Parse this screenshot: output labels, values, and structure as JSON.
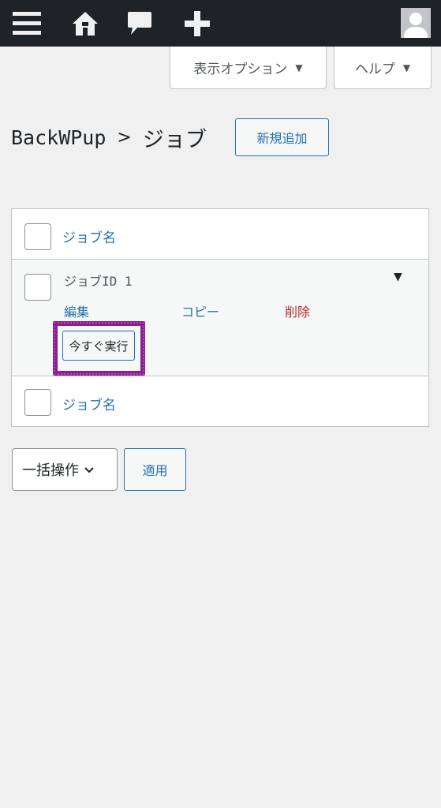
{
  "admin_bar": {
    "icons": [
      "menu-icon",
      "home-icon",
      "comments-icon",
      "plus-icon",
      "user-avatar-icon"
    ]
  },
  "screen_meta": {
    "screen_options_label": "表示オプション",
    "help_label": "ヘルプ"
  },
  "header": {
    "title": "BackWPup",
    "separator": ">",
    "subtitle": "ジョブ",
    "add_new_label": "新規追加"
  },
  "table": {
    "column_header": "ジョブ名",
    "column_footer": "ジョブ名",
    "rows": [
      {
        "name": "ジョブID 1",
        "actions": {
          "edit": "編集",
          "copy": "コピー",
          "delete": "削除",
          "run_now": "今すぐ実行"
        }
      }
    ]
  },
  "bulk": {
    "select_label": "一括操作",
    "apply_label": "適用"
  },
  "colors": {
    "admin_bar": "#1d2327",
    "link": "#2271b1",
    "delete": "#b32d2e",
    "highlight": "#8a1f8e"
  }
}
